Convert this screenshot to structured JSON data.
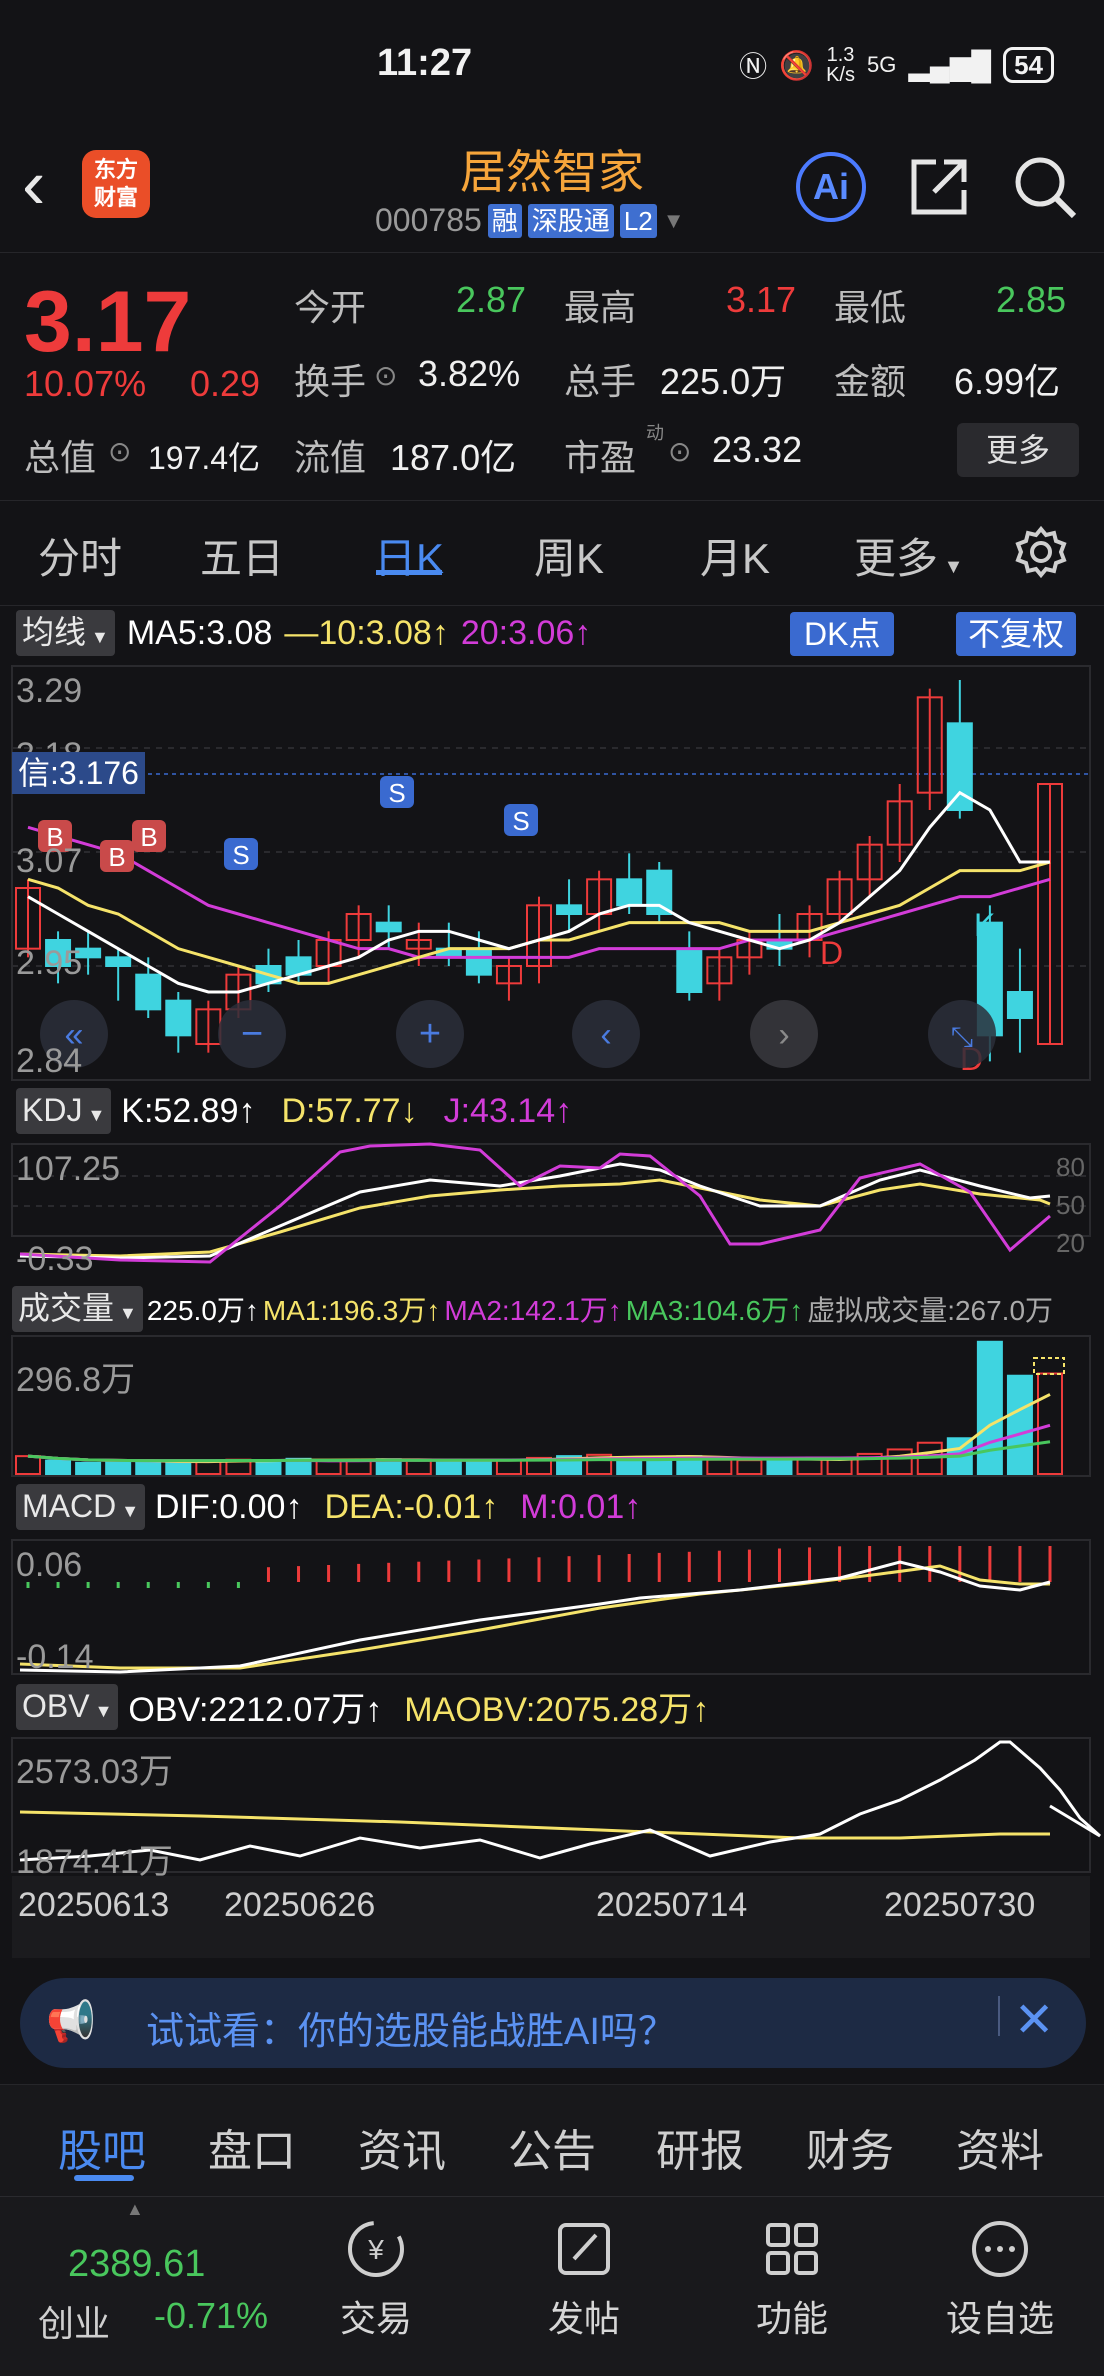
{
  "status": {
    "time": "11:27",
    "net_speed_top": "1.3",
    "net_speed_bottom": "K/s",
    "network": "5G",
    "battery": "54"
  },
  "header": {
    "logo_top": "东方",
    "logo_bottom": "财富",
    "stock_name": "居然智家",
    "stock_code": "000785",
    "tags": [
      "融",
      "深股通",
      "L2"
    ],
    "ai_label": "Ai"
  },
  "quote": {
    "price": "3.17",
    "change_pct": "10.07%",
    "change_amt": "0.29",
    "open_label": "今开",
    "open": "2.87",
    "high_label": "最高",
    "high": "3.17",
    "low_label": "最低",
    "low": "2.85",
    "turnover_label": "换手",
    "turnover": "3.82%",
    "volume_label": "总手",
    "volume": "225.0万",
    "amount_label": "金额",
    "amount": "6.99亿",
    "mcap_label": "总值",
    "mcap": "197.4亿",
    "float_label": "流值",
    "float_cap": "187.0亿",
    "pe_label": "市盈",
    "pe_sup": "动",
    "pe": "23.32",
    "more_label": "更多"
  },
  "tabs": [
    "分时",
    "五日",
    "日K",
    "周K",
    "月K",
    "更多"
  ],
  "kline": {
    "ma_button": "均线",
    "ma5": "MA5:3.08",
    "ma10": "10:3.08",
    "ma20": "20:3.06",
    "dk_label": "DK点",
    "fq_label": "不复权",
    "y_top": "3.29",
    "y_2": "3.18",
    "y_3": "3.07",
    "y_4": "2.95",
    "y_bottom": "2.84",
    "crosshair": "信:3.176",
    "b_marker": "B",
    "s_marker": "S",
    "d_marker": "D",
    "k_marker": "K"
  },
  "kdj": {
    "button": "KDJ",
    "k": "K:52.89",
    "d": "D:57.77",
    "j": "J:43.14",
    "y_top": "107.25",
    "y_bottom": "-0.33",
    "r80": "80",
    "r50": "50",
    "r20": "20"
  },
  "volume": {
    "button": "成交量",
    "vol": "225.0万",
    "ma1": "MA1:196.3万",
    "ma2": "MA2:142.1万",
    "ma3": "MA3:104.6万",
    "virtual": "虚拟成交量:267.0万",
    "y_top": "296.8万"
  },
  "macd": {
    "button": "MACD",
    "dif": "DIF:0.00",
    "dea": "DEA:-0.01",
    "m": "M:0.01",
    "y_top": "0.06",
    "y_bottom": "-0.14"
  },
  "obv": {
    "button": "OBV",
    "obv": "OBV:2212.07万",
    "maobv": "MAOBV:2075.28万",
    "y_top": "2573.03万",
    "y_bottom": "1874.41万"
  },
  "dates": [
    "20250613",
    "20250626",
    "20250714",
    "20250730"
  ],
  "ai_banner": {
    "text": "试试看：你的选股能战胜AI吗？"
  },
  "bottom_tabs": [
    "股吧",
    "盘口",
    "资讯",
    "公告",
    "研报",
    "财务",
    "资料"
  ],
  "footer": {
    "index_value": "2389.61",
    "index_name": "创业",
    "index_change": "-0.71%",
    "items": [
      "交易",
      "发帖",
      "功能",
      "设自选"
    ]
  },
  "colors": {
    "up": "#ee3b3b",
    "down": "#3fd4e0",
    "ma5": "#ffffff",
    "ma10": "#f5e36a",
    "ma20": "#d23cd8",
    "accent": "#4a8af0",
    "name": "#f6a53b"
  },
  "chart_data": {
    "type": "candlestick",
    "ohlc": [
      [
        2.98,
        3.06,
        2.97,
        3.05
      ],
      [
        2.99,
        3.0,
        2.94,
        2.96
      ],
      [
        2.98,
        3.0,
        2.95,
        2.97
      ],
      [
        2.97,
        2.98,
        2.92,
        2.96
      ],
      [
        2.95,
        2.97,
        2.9,
        2.91
      ],
      [
        2.92,
        2.93,
        2.86,
        2.88
      ],
      [
        2.87,
        2.92,
        2.86,
        2.91
      ],
      [
        2.91,
        2.96,
        2.9,
        2.95
      ],
      [
        2.96,
        2.98,
        2.93,
        2.94
      ],
      [
        2.97,
        2.99,
        2.94,
        2.95
      ],
      [
        2.96,
        3.0,
        2.94,
        2.99
      ],
      [
        2.99,
        3.03,
        2.97,
        3.02
      ],
      [
        3.01,
        3.03,
        2.98,
        3.0
      ],
      [
        2.98,
        3.01,
        2.96,
        2.99
      ],
      [
        2.98,
        3.01,
        2.96,
        2.97
      ],
      [
        2.98,
        3.0,
        2.94,
        2.95
      ],
      [
        2.94,
        2.97,
        2.92,
        2.96
      ],
      [
        2.96,
        3.04,
        2.94,
        3.03
      ],
      [
        3.03,
        3.06,
        3.0,
        3.02
      ],
      [
        3.02,
        3.07,
        3.0,
        3.06
      ],
      [
        3.06,
        3.09,
        3.02,
        3.03
      ],
      [
        3.07,
        3.08,
        3.01,
        3.02
      ],
      [
        2.98,
        3.0,
        2.92,
        2.93
      ],
      [
        2.94,
        2.98,
        2.92,
        2.97
      ],
      [
        2.97,
        3.0,
        2.95,
        2.99
      ],
      [
        2.99,
        3.02,
        2.96,
        2.98
      ],
      [
        2.99,
        3.03,
        2.97,
        3.02
      ],
      [
        3.02,
        3.07,
        3.01,
        3.06
      ],
      [
        3.06,
        3.11,
        3.04,
        3.1
      ],
      [
        3.1,
        3.17,
        3.08,
        3.15
      ],
      [
        3.16,
        3.28,
        3.14,
        3.27
      ],
      [
        3.24,
        3.29,
        3.13,
        3.14
      ],
      [
        3.01,
        3.03,
        2.85,
        2.88
      ],
      [
        2.93,
        2.98,
        2.86,
        2.9
      ],
      [
        2.87,
        3.17,
        2.87,
        3.17
      ]
    ],
    "ma5": [
      3.04,
      3.02,
      3.0,
      2.98,
      2.96,
      2.94,
      2.93,
      2.93,
      2.94,
      2.95,
      2.96,
      2.97,
      2.99,
      3.0,
      3.0,
      2.99,
      2.98,
      2.99,
      3.0,
      3.02,
      3.03,
      3.03,
      3.01,
      3.0,
      2.99,
      2.98,
      2.99,
      3.01,
      3.04,
      3.07,
      3.12,
      3.16,
      3.14,
      3.08,
      3.08
    ],
    "ma10": [
      3.06,
      3.05,
      3.03,
      3.02,
      3.0,
      2.98,
      2.97,
      2.96,
      2.95,
      2.94,
      2.94,
      2.95,
      2.96,
      2.97,
      2.98,
      2.98,
      2.98,
      2.99,
      2.99,
      3.0,
      3.01,
      3.01,
      3.01,
      3.01,
      3.0,
      3.0,
      3.0,
      3.01,
      3.02,
      3.03,
      3.05,
      3.07,
      3.07,
      3.07,
      3.08
    ],
    "ma20": [
      3.12,
      3.11,
      3.1,
      3.09,
      3.07,
      3.05,
      3.03,
      3.02,
      3.01,
      3.0,
      2.99,
      2.98,
      2.98,
      2.97,
      2.97,
      2.97,
      2.97,
      2.97,
      2.97,
      2.98,
      2.98,
      2.98,
      2.98,
      2.98,
      2.99,
      2.99,
      2.99,
      3.0,
      3.01,
      3.02,
      3.03,
      3.04,
      3.04,
      3.05,
      3.06
    ],
    "volume_wan": [
      40,
      30,
      25,
      27,
      28,
      30,
      29,
      32,
      30,
      34,
      30,
      31,
      33,
      30,
      32,
      30,
      31,
      36,
      40,
      43,
      38,
      35,
      40,
      32,
      31,
      30,
      33,
      36,
      45,
      55,
      70,
      80,
      296,
      220,
      225
    ],
    "ylim": [
      2.84,
      3.29
    ]
  }
}
